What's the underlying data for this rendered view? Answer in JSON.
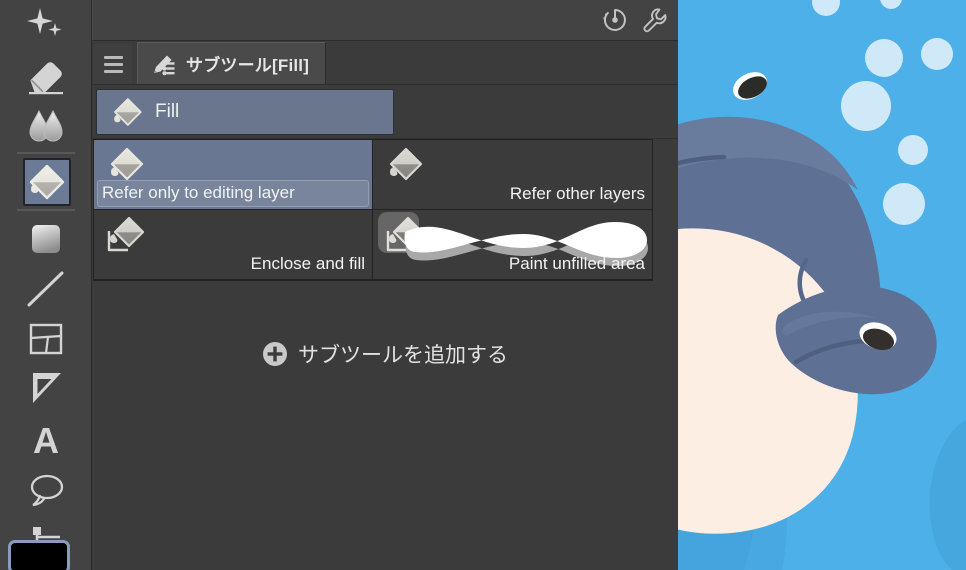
{
  "app": {
    "theme_bg": "#3b3b3b",
    "accent_selected": "#69768e",
    "accent_swatch_border": "#8b9bc0"
  },
  "tool_rail": {
    "name": "tool-rail",
    "items": [
      {
        "id": "decoration",
        "icon": "sparkle-icon",
        "selected": false
      },
      {
        "id": "eraser",
        "icon": "eraser-icon",
        "selected": false
      },
      {
        "id": "blend",
        "icon": "blend-icon",
        "selected": false
      },
      {
        "id": "fill",
        "icon": "paint-bucket-icon",
        "selected": true
      },
      {
        "id": "gradient",
        "icon": "gradient-icon",
        "selected": false
      },
      {
        "id": "figure",
        "icon": "line-icon",
        "selected": false
      },
      {
        "id": "frame-border",
        "icon": "frame-border-icon",
        "selected": false
      },
      {
        "id": "ruler",
        "icon": "ruler-icon",
        "selected": false
      },
      {
        "id": "text",
        "icon": "text-a-icon",
        "selected": false
      },
      {
        "id": "balloon",
        "icon": "speech-balloon-icon",
        "selected": false
      },
      {
        "id": "operation",
        "icon": "operation-cursor-icon",
        "selected": false
      }
    ],
    "color_swatch": {
      "name": "main-color-swatch",
      "color": "#000000"
    }
  },
  "top_strip": {
    "icons": [
      {
        "id": "history",
        "icon": "gauge-history-icon"
      },
      {
        "id": "settings",
        "icon": "wrench-icon"
      }
    ]
  },
  "panel": {
    "menu_icon": "hamburger-menu-icon",
    "tab": {
      "icon": "subtool-pencil-icon",
      "label": "サブツール[Fill]"
    },
    "current_subtool": {
      "icon": "paint-bucket-icon",
      "label": "Fill"
    },
    "subtools": [
      {
        "label": "Refer only to editing layer",
        "icon": "paint-bucket-icon",
        "selected": true,
        "has_preview_stroke": false
      },
      {
        "label": "Refer other layers",
        "icon": "paint-bucket-icon",
        "selected": false,
        "has_preview_stroke": false
      },
      {
        "label": "Enclose and fill",
        "icon": "enclose-fill-icon",
        "selected": false,
        "has_preview_stroke": false
      },
      {
        "label": "Paint unfilled area",
        "icon": "enclose-fill-icon",
        "selected": false,
        "has_preview_stroke": true
      }
    ],
    "add_subtool": {
      "icon": "plus-circle-icon",
      "label": "サブツールを追加する"
    }
  },
  "canvas_art": {
    "name": "whale-illustration",
    "colors": {
      "water": "#4db0e8",
      "water_shadow": "#3f9bd3",
      "body": "#5e7093",
      "body_light": "#6a7c9e",
      "belly": "#fceee2",
      "eye_white": "#ffffff",
      "eye_dark": "#2b2b28",
      "bubble": "#cfe9f8"
    }
  }
}
